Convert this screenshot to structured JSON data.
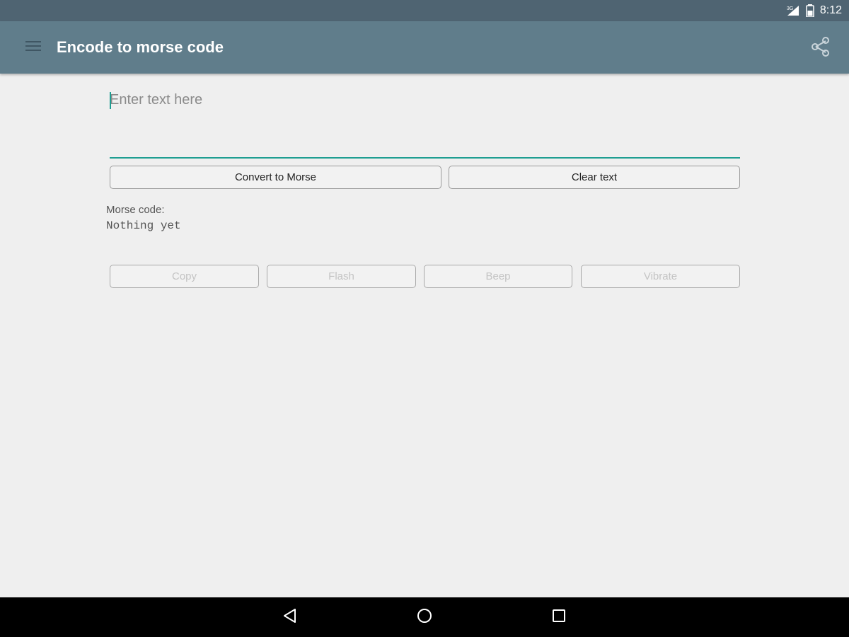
{
  "status_bar": {
    "time": "8:12",
    "network_label": "3G"
  },
  "app_bar": {
    "title": "Encode to morse code"
  },
  "input": {
    "placeholder": "Enter text here",
    "value": ""
  },
  "actions": {
    "convert_label": "Convert to Morse",
    "clear_label": "Clear text"
  },
  "output": {
    "label": "Morse code:",
    "value": "Nothing yet"
  },
  "output_actions": {
    "copy_label": "Copy",
    "flash_label": "Flash",
    "beep_label": "Beep",
    "vibrate_label": "Vibrate"
  },
  "colors": {
    "status_bar": "#4f6472",
    "app_bar": "#607d8b",
    "accent": "#1f9e92",
    "background": "#efefef"
  },
  "icons": {
    "menu": "hamburger-menu-icon",
    "share": "share-icon",
    "signal": "signal-icon",
    "battery": "battery-icon",
    "back": "back-triangle-icon",
    "home": "home-circle-icon",
    "recents": "recents-square-icon"
  }
}
